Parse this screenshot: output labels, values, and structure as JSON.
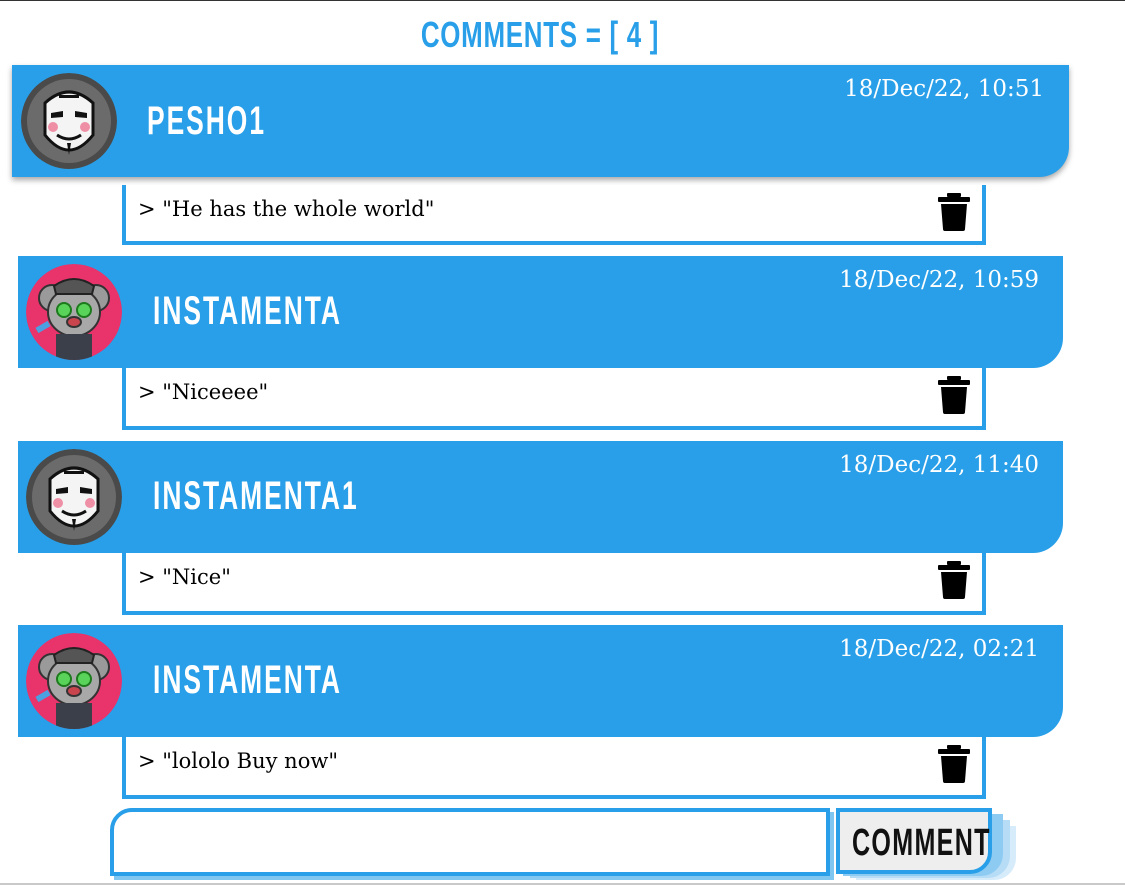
{
  "header": {
    "title": "COMMENTS = [ 4 ]"
  },
  "comments": [
    {
      "username": "PESHO1",
      "timestamp": "18/Dec/22, 10:51",
      "text": "> \"He has the whole world\"",
      "avatar": "guy-fawkes-mask-avatar",
      "delete_icon": "trash-icon"
    },
    {
      "username": "INSTAMENTA",
      "timestamp": "18/Dec/22, 10:59",
      "text": "> \"Niceeee\"",
      "avatar": "koala-cartoon-avatar",
      "delete_icon": "trash-icon"
    },
    {
      "username": "INSTAMENTA1",
      "timestamp": "18/Dec/22, 11:40",
      "text": "> \"Nice\"",
      "avatar": "guy-fawkes-mask-avatar",
      "delete_icon": "trash-icon"
    },
    {
      "username": "INSTAMENTA",
      "timestamp": "18/Dec/22, 02:21",
      "text": "> \"lololo Buy now\"",
      "avatar": "koala-cartoon-avatar",
      "delete_icon": "trash-icon"
    }
  ],
  "composer": {
    "input_value": "",
    "button_label": "COMMENT"
  },
  "colors": {
    "accent": "#289fe8",
    "button_bg": "#eeeeee",
    "text": "#000000",
    "mask_avatar_bg": "#4a4a4a",
    "koala_avatar_bg": "#e8336b"
  }
}
